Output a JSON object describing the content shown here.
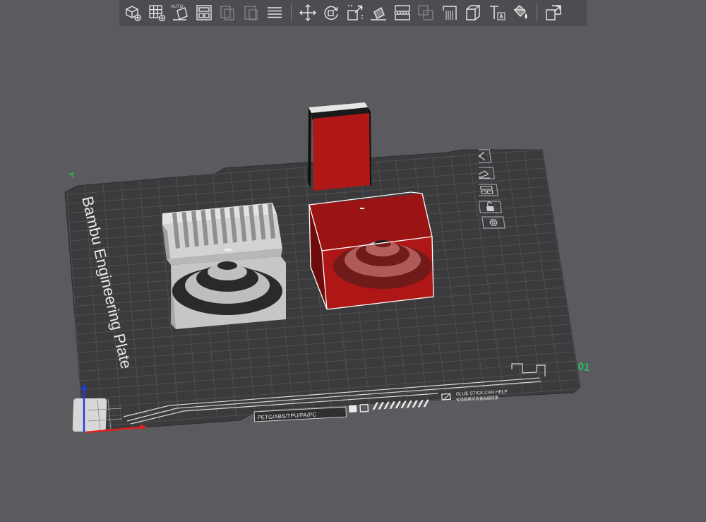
{
  "toolbar": {
    "buttons": [
      {
        "name": "add-object-button",
        "icon": "add-cube-icon"
      },
      {
        "name": "add-plate-button",
        "icon": "grid-plus-icon"
      },
      {
        "name": "auto-orient-button",
        "icon": "auto-orient-icon",
        "label": "AUTO"
      },
      {
        "name": "arrange-button",
        "icon": "arrange-icon"
      },
      {
        "name": "copy-button",
        "icon": "copy-icon",
        "disabled": true
      },
      {
        "name": "paste-button",
        "icon": "paste-icon",
        "disabled": true
      },
      {
        "name": "layers-button",
        "icon": "layers-icon"
      },
      {
        "name": "move-button",
        "icon": "move-icon"
      },
      {
        "name": "rotate-button",
        "icon": "rotate-icon"
      },
      {
        "name": "scale-button",
        "icon": "scale-icon"
      },
      {
        "name": "lay-on-face-button",
        "icon": "lay-on-face-icon"
      },
      {
        "name": "cut-button",
        "icon": "cut-icon"
      },
      {
        "name": "boolean-button",
        "icon": "boolean-icon",
        "disabled": true
      },
      {
        "name": "support-paint-button",
        "icon": "support-paint-icon"
      },
      {
        "name": "seam-paint-button",
        "icon": "seam-paint-icon"
      },
      {
        "name": "text-button",
        "icon": "text-icon"
      },
      {
        "name": "color-paint-button",
        "icon": "color-paint-icon"
      },
      {
        "name": "assembly-view-button",
        "icon": "assembly-icon"
      }
    ]
  },
  "plate": {
    "name": "Bambu Engineering Plate",
    "number": "01",
    "material_label": "PETG/ABS/TPU/PA/PC",
    "glue_note": "GLUE STICK CAN HELP",
    "glue_note_cn": "专用胶棒可改善粘接效果",
    "origin_mark": "A"
  },
  "plate_tools": [
    {
      "name": "delete-plate-button",
      "icon": "close-x-icon"
    },
    {
      "name": "auto-orient-plate-button",
      "icon": "orient-plate-icon"
    },
    {
      "name": "arrange-plate-button",
      "icon": "arrange-plate-icon"
    },
    {
      "name": "lock-plate-button",
      "icon": "lock-icon"
    },
    {
      "name": "plate-settings-button",
      "icon": "settings-gear-icon"
    }
  ],
  "colors": {
    "background": "#5b5b5f",
    "plate": "#3b3b3d",
    "grid": "#505053",
    "object_red": "#b01717",
    "object_gray": "#c9c9c9",
    "selection": "#ffffff",
    "plate_number": "#22c55e",
    "axis_x": "#e0201b",
    "axis_y": "#22c55e",
    "axis_z": "#1f3fd8"
  }
}
